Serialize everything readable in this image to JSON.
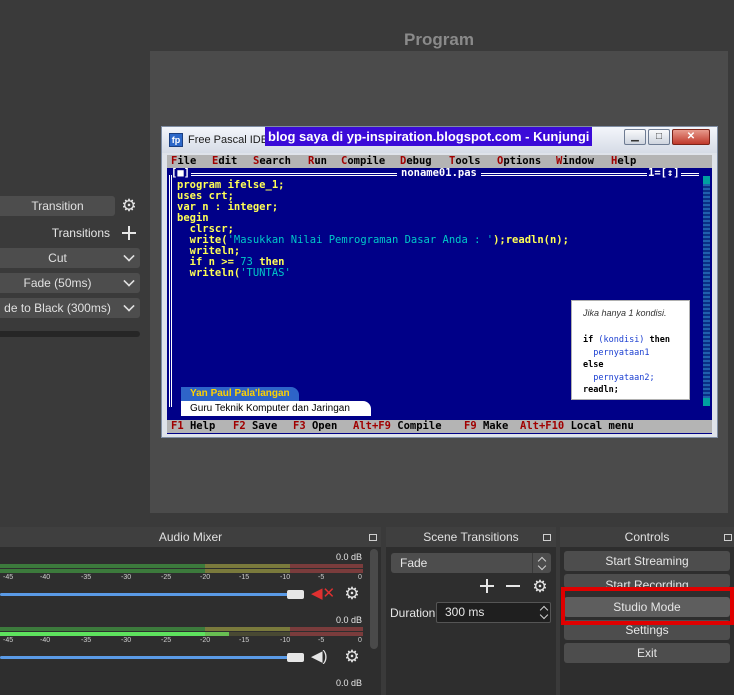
{
  "program": {
    "title": "Program"
  },
  "fpwindow": {
    "title": "Free Pascal IDE",
    "logo": "fp",
    "banner": "blog saya di yp-inspiration.blogspot.com - Kunjungi",
    "menu": [
      {
        "hot": "F",
        "rest": "ile"
      },
      {
        "hot": "E",
        "rest": "dit"
      },
      {
        "hot": "S",
        "rest": "earch"
      },
      {
        "hot": "R",
        "rest": "un"
      },
      {
        "hot": "C",
        "rest": "ompile"
      },
      {
        "hot": "D",
        "rest": "ebug"
      },
      {
        "hot": "T",
        "rest": "ools"
      },
      {
        "hot": "O",
        "rest": "ptions"
      },
      {
        "hot": "W",
        "rest": "indow"
      },
      {
        "hot": "H",
        "rest": "elp"
      }
    ],
    "frame_left": "[■]",
    "frame_right": "1=[↕]",
    "filename": "noname01.pas",
    "code": {
      "l1": "program ifelse_1;",
      "l2": "uses crt;",
      "l3": "var n : integer;",
      "l4": "begin",
      "l5": "  clrscr;",
      "l6a": "  write(",
      "l6b": "'Masukkan Nilai Pemrograman Dasar Anda : '",
      "l6c": ");readln(n);",
      "l7": "  writeln;",
      "l8a": "  if n >= ",
      "l8b": "73",
      "l8c": " then",
      "l9a": "  writeln(",
      "l9b": "'TUNTAS'"
    },
    "status": [
      {
        "hot": "F1",
        "rest": " Help"
      },
      {
        "hot": "F2",
        "rest": " Save"
      },
      {
        "hot": "F3",
        "rest": " Open"
      },
      {
        "hot": "Alt+F9",
        "rest": " Compile"
      },
      {
        "hot": "F9",
        "rest": " Make"
      },
      {
        "hot": "Alt+F10",
        "rest": " Local menu"
      }
    ]
  },
  "note": {
    "title": "Jika hanya 1 kondisi.",
    "l1a": "if",
    "l1b": " (kondisi) ",
    "l1c": "then",
    "l2": "  pernyataan1",
    "l3": "else",
    "l4": "  pernyataan2;",
    "l5": "readln;"
  },
  "lower_third": {
    "name": "Yan Paul Pala'langan",
    "role": "Guru Teknik Komputer dan Jaringan"
  },
  "transitions_panel": {
    "transition_button": "Transition",
    "transitions_label": "Transitions",
    "cut": "Cut",
    "fade": "Fade (50ms)",
    "fade_black": "de to Black (300ms)"
  },
  "audio_mixer": {
    "title": "Audio Mixer",
    "ch1_db": "0.0 dB",
    "ch2_db": "0.0 dB",
    "ch3_db": "0.0 dB",
    "ticks": [
      "-45",
      "-40",
      "-35",
      "-30",
      "-25",
      "-20",
      "-15",
      "-10",
      "-5",
      "0"
    ],
    "ch2_level": 0.63
  },
  "scene_transitions": {
    "title": "Scene Transitions",
    "selected": "Fade",
    "duration_label": "Duration",
    "duration_value": "300 ms"
  },
  "controls": {
    "title": "Controls",
    "start_streaming": "Start Streaming",
    "start_recording": "Start Recording",
    "studio_mode": "Studio Mode",
    "settings": "Settings",
    "exit": "Exit"
  },
  "colors": {
    "accent_blue": "#5a9ae6",
    "highlight_red": "#e00000",
    "ide_blue": "#000088"
  }
}
